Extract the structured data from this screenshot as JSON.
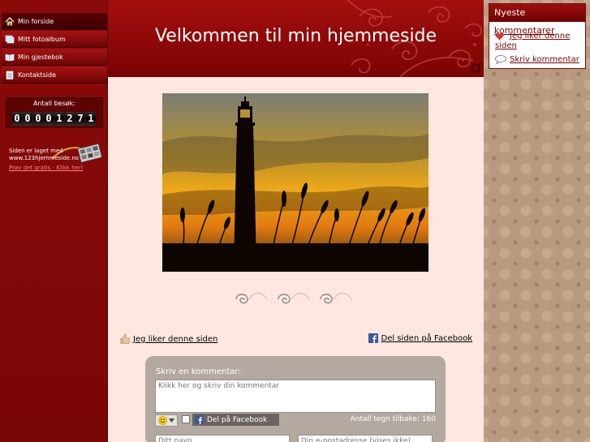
{
  "nav": {
    "items": [
      {
        "label": "Min forside",
        "icon": "home-icon"
      },
      {
        "label": "Mitt fotoalbum",
        "icon": "photo-album-icon"
      },
      {
        "label": "Min gjestebok",
        "icon": "guestbook-icon"
      },
      {
        "label": "Kontaktside",
        "icon": "contact-icon"
      }
    ]
  },
  "visits": {
    "label": "Antall besøk:",
    "digits": [
      "0",
      "0",
      "0",
      "0",
      "1",
      "2",
      "7",
      "1"
    ]
  },
  "promo": {
    "made_with": "Siden er laget med www.123hjemmeside.no",
    "try_link": "Prøv det gratis - Klikk her!"
  },
  "header": {
    "title": "Velkommen til min hjemmeside"
  },
  "main": {
    "like_label": "Jeg liker denne siden",
    "facebook_share_label": "Del siden på Facebook"
  },
  "comment": {
    "title": "Skriv en kommentar:",
    "text_placeholder": "Klikk her og skriv din kommentar",
    "fb_button_label": "Del på Facebook",
    "chars_left": "Antall tegn tilbake: 160",
    "name_placeholder": "Ditt navn",
    "email_placeholder": "Din e-postadresse (vises ikke)"
  },
  "latest": {
    "title": "Nyeste",
    "title_overflow": "kommentarer",
    "like_label": "Jeg liker denne siden",
    "comment_label": "Skriv kommentar"
  },
  "colors": {
    "brand": "#8a0a0a",
    "content_bg": "#fde7e0",
    "right_bg": "#b89a80"
  }
}
